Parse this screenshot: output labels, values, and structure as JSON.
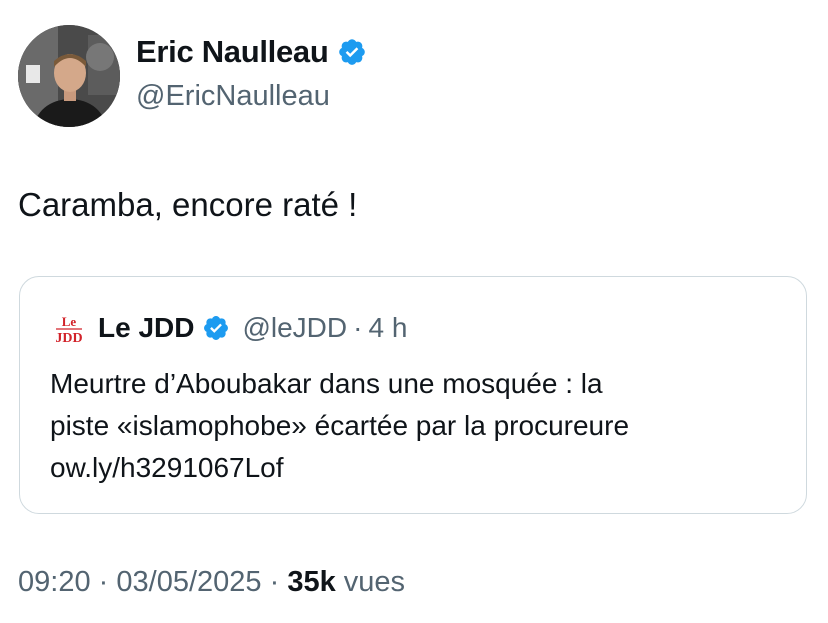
{
  "author": {
    "name": "Eric Naulleau",
    "handle": "@EricNaulleau",
    "verified": true
  },
  "tweet": {
    "text": "Caramba, encore raté !"
  },
  "quoted_tweet": {
    "logo_text_top": "Le",
    "logo_text_bottom": "JDD",
    "name": "Le JDD",
    "handle": "@leJDD",
    "separator": "·",
    "time": "4 h",
    "verified": true,
    "body_lines": [
      "Meurtre d’Aboubakar dans une mosquée : la",
      "piste «islamophobe» écartée par la procureure",
      "ow.ly/h3291067Lof"
    ]
  },
  "meta": {
    "time": "09:20",
    "date": "03/05/2025",
    "separator": "·",
    "views_count": "35k",
    "views_label": "vues"
  },
  "colors": {
    "verified_blue": "#1d9bf0",
    "secondary_text": "#536471",
    "primary_text": "#0f1419",
    "card_border": "#cfd9de",
    "jdd_red": "#d2232a"
  }
}
